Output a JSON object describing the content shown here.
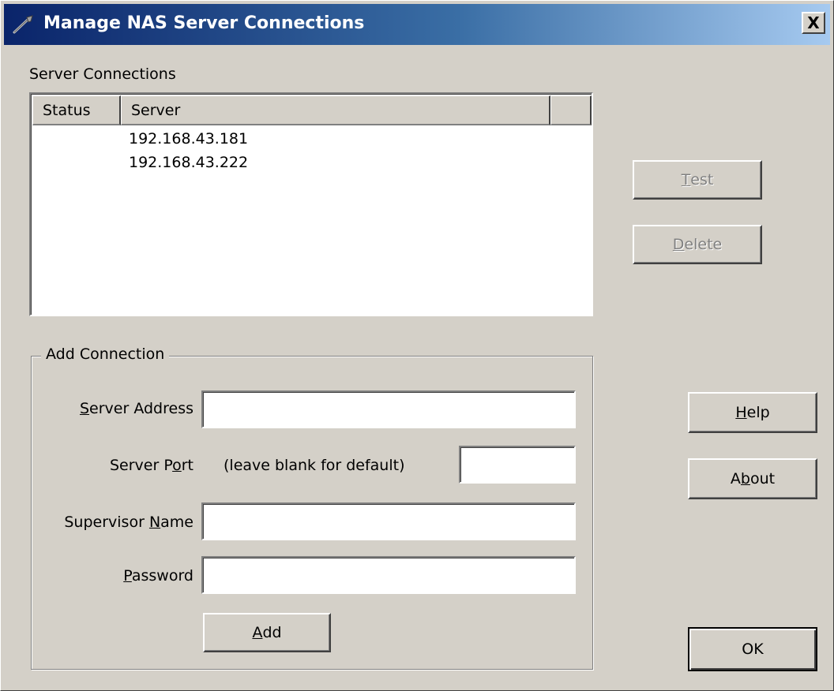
{
  "window": {
    "title": "Manage NAS Server Connections",
    "close_symbol": "X"
  },
  "connections": {
    "label": "Server Connections",
    "columns": [
      "Status",
      "Server",
      ""
    ],
    "rows": [
      {
        "status": "",
        "server": "192.168.43.181"
      },
      {
        "status": "",
        "server": "192.168.43.222"
      }
    ]
  },
  "buttons": {
    "test": {
      "pre": "",
      "mn": "T",
      "post": "est"
    },
    "delete": {
      "pre": "",
      "mn": "D",
      "post": "elete"
    },
    "help": {
      "pre": "",
      "mn": "H",
      "post": "elp"
    },
    "about": {
      "pre": "A",
      "mn": "b",
      "post": "out"
    },
    "ok": "OK",
    "add": {
      "pre": "",
      "mn": "A",
      "post": "dd"
    }
  },
  "add_connection": {
    "title": "Add Connection",
    "server_address": {
      "pre": "",
      "mn": "S",
      "post": "erver Address",
      "value": ""
    },
    "server_port": {
      "pre": "Server P",
      "mn": "o",
      "post": "rt",
      "hint": "(leave blank for default)",
      "value": ""
    },
    "supervisor_name": {
      "pre": "Supervisor ",
      "mn": "N",
      "post": "ame",
      "value": ""
    },
    "password": {
      "pre": "",
      "mn": "P",
      "post": "assword",
      "value": ""
    }
  },
  "colors": {
    "titlebar_start": "#0a246a",
    "titlebar_end": "#a6caf0",
    "face": "#d4d0c8"
  },
  "icons": [
    "wrench-icon",
    "close-icon"
  ]
}
